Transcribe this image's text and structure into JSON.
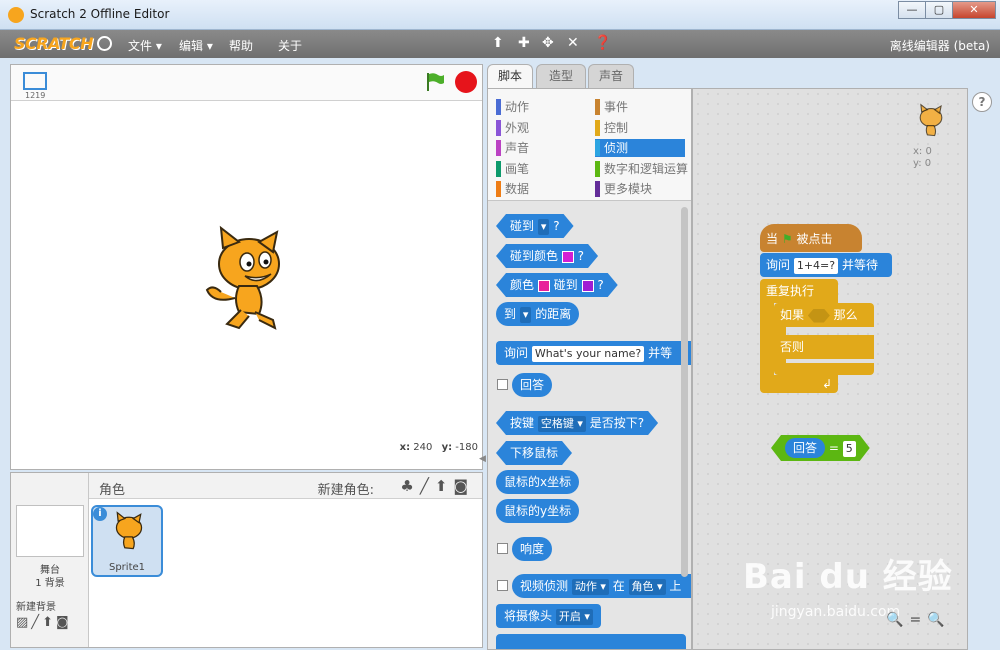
{
  "window": {
    "title": "Scratch 2 Offline Editor",
    "minimize": "—",
    "maximize": "▢",
    "close": "✕"
  },
  "menubar": {
    "logo": "SCRATCH",
    "file": "文件 ▾",
    "edit": "编辑 ▾",
    "help": "帮助",
    "about": "关于",
    "mode": "离线编辑器 (beta)",
    "tools": [
      "duplicate-icon",
      "delete-icon",
      "grow-icon",
      "shrink-icon",
      "help-icon"
    ]
  },
  "stage": {
    "version": "1219",
    "mouse_x_label": "x:",
    "mouse_x": "240",
    "mouse_y_label": "y:",
    "mouse_y": "-180"
  },
  "sprites": {
    "stage_label": "舞台",
    "backdrop_count": "1 背景",
    "new_backdrop": "新建背景",
    "header": "角色",
    "new_sprite": "新建角色:",
    "sprite_name": "Sprite1"
  },
  "tabs": [
    "脚本",
    "造型",
    "声音"
  ],
  "categories": [
    {
      "label": "动作",
      "color": "#4a6cd4"
    },
    {
      "label": "外观",
      "color": "#8a55d7"
    },
    {
      "label": "声音",
      "color": "#bb42c3"
    },
    {
      "label": "画笔",
      "color": "#0e9a6c"
    },
    {
      "label": "数据",
      "color": "#ee7d16"
    },
    {
      "label": "事件",
      "color": "#c88330"
    },
    {
      "label": "控制",
      "color": "#e1a91a"
    },
    {
      "label": "侦测",
      "color": "#2ca5e2"
    },
    {
      "label": "数字和逻辑运算",
      "color": "#5cb712"
    },
    {
      "label": "更多模块",
      "color": "#632d99"
    }
  ],
  "blocks": {
    "touching": "碰到",
    "touching_color": "碰到颜色",
    "color": "颜色",
    "color_touching": "碰到",
    "distance_to": "到",
    "distance_suffix": "的距离",
    "ask": "询问",
    "ask_default": "What's your name?",
    "ask_wait": "并等",
    "answer": "回答",
    "key": "按键",
    "key_value": "空格键",
    "key_pressed": "是否按下?",
    "mouse_down": "下移鼠标",
    "mouse_x": "鼠标的x坐标",
    "mouse_y": "鼠标的y坐标",
    "loudness": "响度",
    "video_sensing": "视频侦测",
    "video_attr": "动作",
    "video_on": "在",
    "video_target": "角色",
    "video_up": "上",
    "camera": "将摄像头",
    "camera_state": "开启",
    "question_mark": "?"
  },
  "script": {
    "when_flag": "当",
    "clicked": "被点击",
    "ask": "询问",
    "ask_value": "1+4=?",
    "and_wait": "并等待",
    "forever": "重复执行",
    "if": "如果",
    "then": "那么",
    "else": "否则",
    "answer": "回答",
    "equals": "=",
    "answer_value": "5"
  },
  "sprite_info": {
    "x": "x: 0",
    "y": "y: 0"
  },
  "watermark": {
    "brand": "Bai du 经验",
    "url": "jingyan.baidu.com"
  },
  "help_button": "?"
}
